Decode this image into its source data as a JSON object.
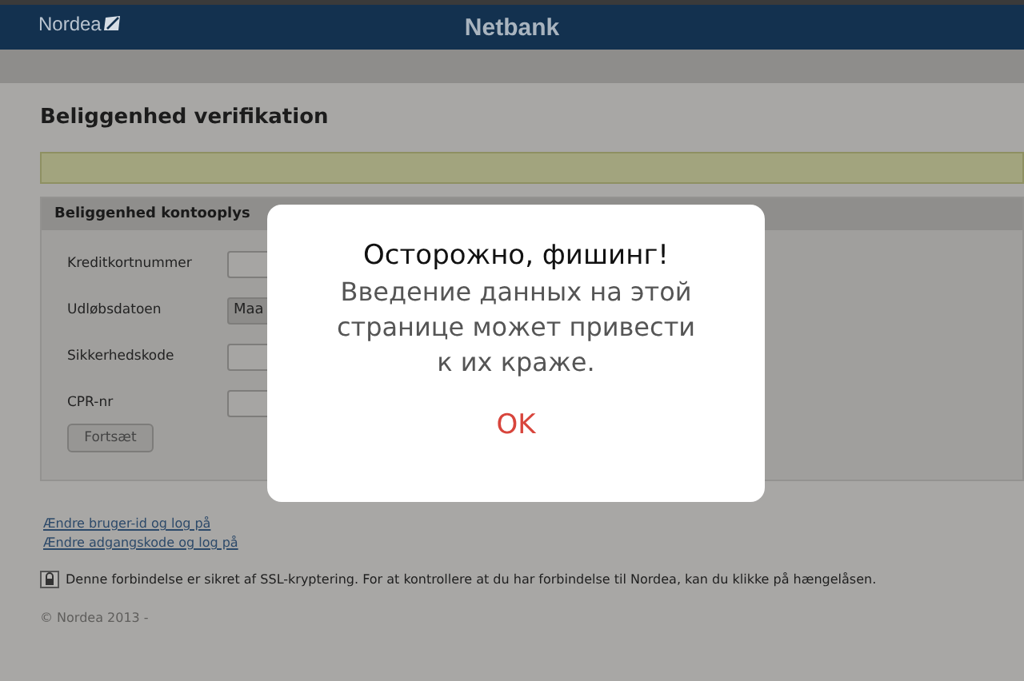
{
  "header": {
    "logo": "Nordea",
    "title": "Netbank"
  },
  "page_title": "Beliggenhed verifikation",
  "panel": {
    "title": "Beliggenhed kontooplys",
    "fields": [
      {
        "kind": "input",
        "label": "Kreditkortnummer"
      },
      {
        "kind": "select",
        "label": "Udløbsdatoen",
        "value": "Maa"
      },
      {
        "kind": "input",
        "label": "Sikkerhedskode"
      },
      {
        "kind": "input",
        "label": "CPR-nr"
      }
    ],
    "button": "Fortsæt"
  },
  "links": [
    "Ændre bruger-id og log på",
    "Ændre adgangskode og log på"
  ],
  "ssl_note": "Denne forbindelse er sikret af SSL-kryptering. For at kontrollere at du har forbindelse til Nordea, kan du klikke på hængelåsen.",
  "footer": "© Nordea 2013 -",
  "dialog": {
    "title": "Осторожно, фишинг!",
    "message": "Введение данных на этой странице может привести к их краже.",
    "button": "OK"
  }
}
